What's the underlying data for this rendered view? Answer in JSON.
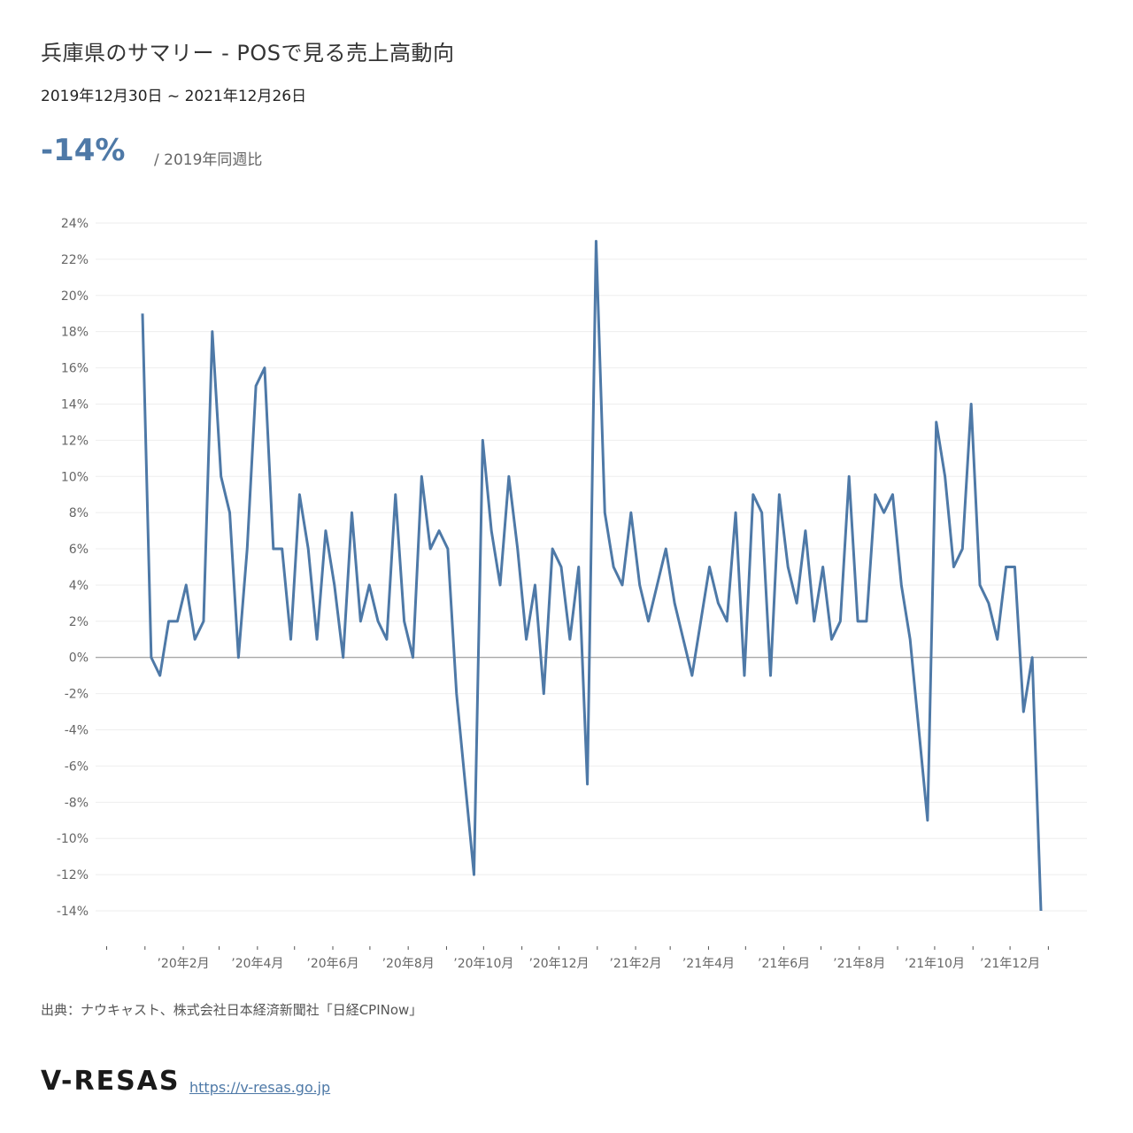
{
  "header": {
    "title": "兵庫県のサマリー - POSで見る売上高動向",
    "period": "2019年12月30日 ~ 2021年12月26日"
  },
  "kpi": {
    "value": "-14%",
    "label": "/ 2019年同週比"
  },
  "footer": {
    "source": "出典：ナウキャスト、株式会社日本経済新聞社「日経CPINow」",
    "logo": "V-RESAS",
    "url": "https://v-resas.go.jp"
  },
  "colors": {
    "line": "#4e79a7",
    "kpi": "#4e79a7",
    "grid": "#eeeeee",
    "zero_line": "#888888",
    "axis_text": "#666666"
  },
  "chart_data": {
    "type": "line",
    "title": "",
    "xlabel": "",
    "ylabel": "",
    "ylim": [
      -14,
      24
    ],
    "grid": true,
    "y_ticks": [
      24,
      22,
      20,
      18,
      16,
      14,
      12,
      10,
      8,
      6,
      4,
      2,
      0,
      -2,
      -4,
      -6,
      -8,
      -10,
      -12,
      -14
    ],
    "y_tick_labels": [
      "24%",
      "22%",
      "20%",
      "18%",
      "16%",
      "14%",
      "12%",
      "10%",
      "8%",
      "6%",
      "4%",
      "2%",
      "0%",
      "-2%",
      "-4%",
      "-6%",
      "-8%",
      "-10%",
      "-12%",
      "-14%"
    ],
    "x_start": "2019-12-30",
    "x_end": "2021-12-26",
    "x_tick_dates": [
      "2020-02-01",
      "2020-04-01",
      "2020-06-01",
      "2020-08-01",
      "2020-10-01",
      "2020-12-01",
      "2021-02-01",
      "2021-04-01",
      "2021-06-01",
      "2021-08-01",
      "2021-10-01",
      "2021-12-01"
    ],
    "x_tick_labels": [
      "’20年2月",
      "’20年4月",
      "’20年6月",
      "’20年8月",
      "’20年10月",
      "’20年12月",
      "’21年2月",
      "’21年4月",
      "’21年6月",
      "’21年8月",
      "’21年10月",
      "’21年12月"
    ],
    "series": [
      {
        "values": [
          19,
          0,
          -1,
          2,
          2,
          4,
          1,
          2,
          18,
          10,
          8,
          0,
          6,
          15,
          16,
          6,
          6,
          1,
          9,
          6,
          1,
          7,
          4,
          0,
          8,
          2,
          4,
          2,
          1,
          9,
          2,
          0,
          10,
          6,
          7,
          6,
          -2,
          -7,
          -12,
          12,
          7,
          4,
          10,
          6,
          1,
          4,
          -2,
          6,
          5,
          1,
          5,
          -7,
          23,
          8,
          5,
          4,
          8,
          4,
          2,
          4,
          6,
          3,
          1,
          -1,
          2,
          5,
          3,
          2,
          8,
          -1,
          9,
          8,
          -1,
          9,
          5,
          3,
          7,
          2,
          5,
          1,
          2,
          10,
          2,
          2,
          9,
          8,
          9,
          4,
          1,
          -4,
          -9,
          13,
          10,
          5,
          6,
          14,
          4,
          3,
          1,
          5,
          5,
          -3,
          0,
          -14
        ]
      }
    ]
  }
}
